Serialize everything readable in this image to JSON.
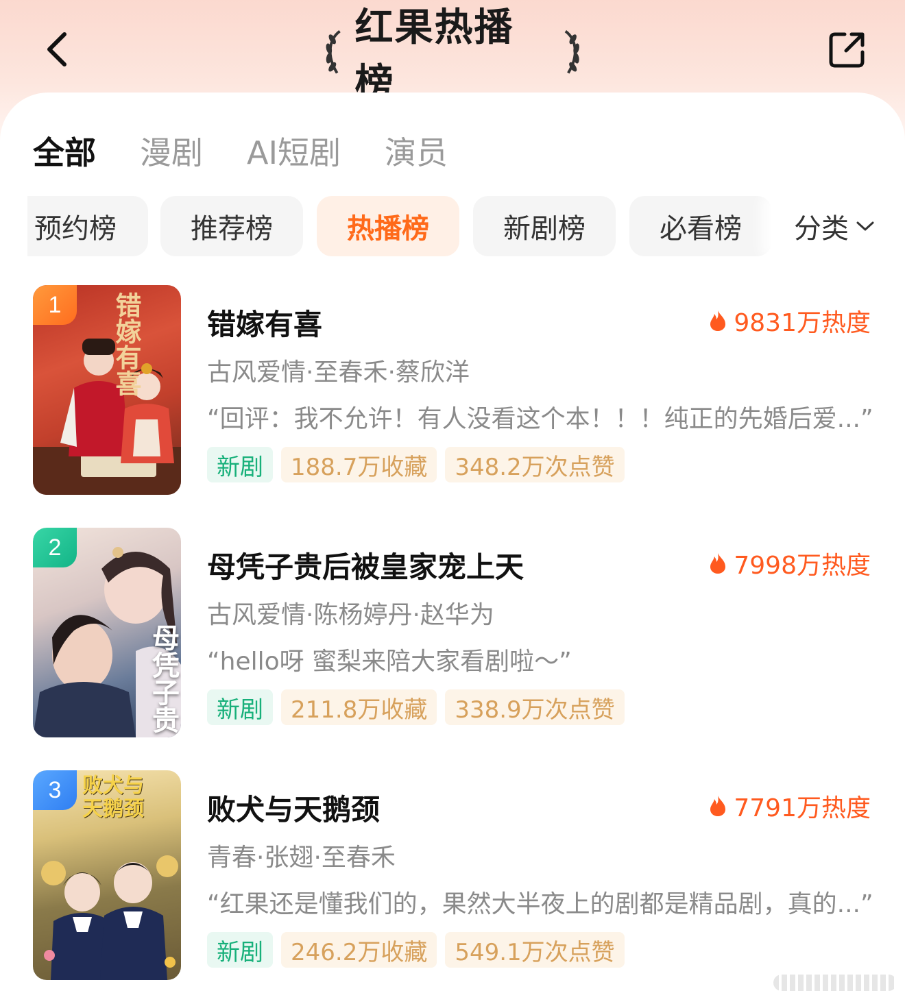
{
  "header": {
    "title": "红果热播榜",
    "back_icon": "chevron-left-icon",
    "share_icon": "share-icon"
  },
  "tabs": [
    {
      "label": "全部",
      "active": true
    },
    {
      "label": "漫剧",
      "active": false
    },
    {
      "label": "AI短剧",
      "active": false
    },
    {
      "label": "演员",
      "active": false
    }
  ],
  "chips": [
    {
      "label": "预约榜",
      "active": false
    },
    {
      "label": "推荐榜",
      "active": false
    },
    {
      "label": "热播榜",
      "active": true
    },
    {
      "label": "新剧榜",
      "active": false
    },
    {
      "label": "必看榜",
      "active": false
    }
  ],
  "filter": {
    "label": "分类",
    "icon": "chevron-down-icon"
  },
  "colors": {
    "accent": "#ff5a1f",
    "new_tag": "#17b07a",
    "stat_tag": "#d7a15c"
  },
  "list": [
    {
      "rank": "1",
      "title": "错嫁有喜",
      "heat": "9831万热度",
      "meta": "古风爱情·至春禾·蔡欣洋",
      "quote": "“回评：我不允许！有人没看这个本！！！纯正的先婚后爱...”",
      "tags": [
        "新剧",
        "188.7万收藏",
        "348.2万次点赞"
      ],
      "poster_text": "错嫁有喜"
    },
    {
      "rank": "2",
      "title": "母凭子贵后被皇家宠上天",
      "heat": "7998万热度",
      "meta": "古风爱情·陈杨婷丹·赵华为",
      "quote": "“hello呀 蜜梨来陪大家看剧啦～”",
      "tags": [
        "新剧",
        "211.8万收藏",
        "338.9万次点赞"
      ],
      "poster_text": "母凭子贵"
    },
    {
      "rank": "3",
      "title": "败犬与天鹅颈",
      "heat": "7791万热度",
      "meta": "青春·张翅·至春禾",
      "quote": "“红果还是懂我们的，果然大半夜上的剧都是精品剧，真的...”",
      "tags": [
        "新剧",
        "246.2万收藏",
        "549.1万次点赞"
      ],
      "poster_text": "败犬与天鹅颈"
    }
  ]
}
